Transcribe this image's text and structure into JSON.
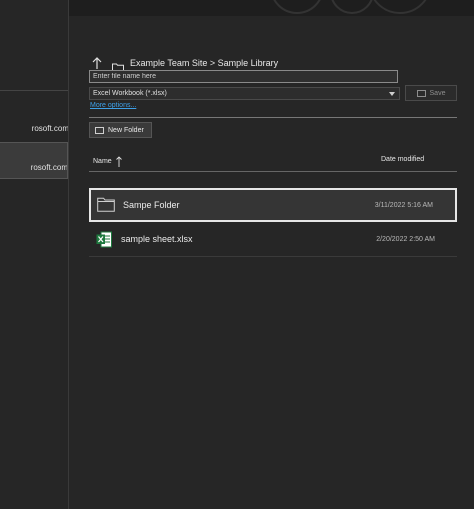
{
  "breadcrumb": {
    "text": "Example Team Site > Sample Library"
  },
  "left_nav": {
    "items": [
      {
        "label": "rosoft.com"
      },
      {
        "label": "rosoft.com"
      }
    ]
  },
  "save_panel": {
    "filename_placeholder": "Enter file name here",
    "filetype_selected": "Excel Workbook (*.xlsx)",
    "save_label": "Save",
    "more_options_label": "More options...",
    "new_folder_label": "New Folder"
  },
  "file_list": {
    "columns": {
      "name": "Name",
      "date": "Date modified"
    },
    "rows": [
      {
        "name": "Sampe Folder",
        "date": "3/11/2022 5:16 AM",
        "icon": "folder-icon"
      },
      {
        "name": "sample sheet.xlsx",
        "date": "2/20/2022 2:50 AM",
        "icon": "excel-file-icon"
      }
    ]
  },
  "colors": {
    "background": "#262626",
    "link": "#3ea0e8",
    "excel_green": "#1d7a3e",
    "selection_border": "#e6e6e6"
  }
}
